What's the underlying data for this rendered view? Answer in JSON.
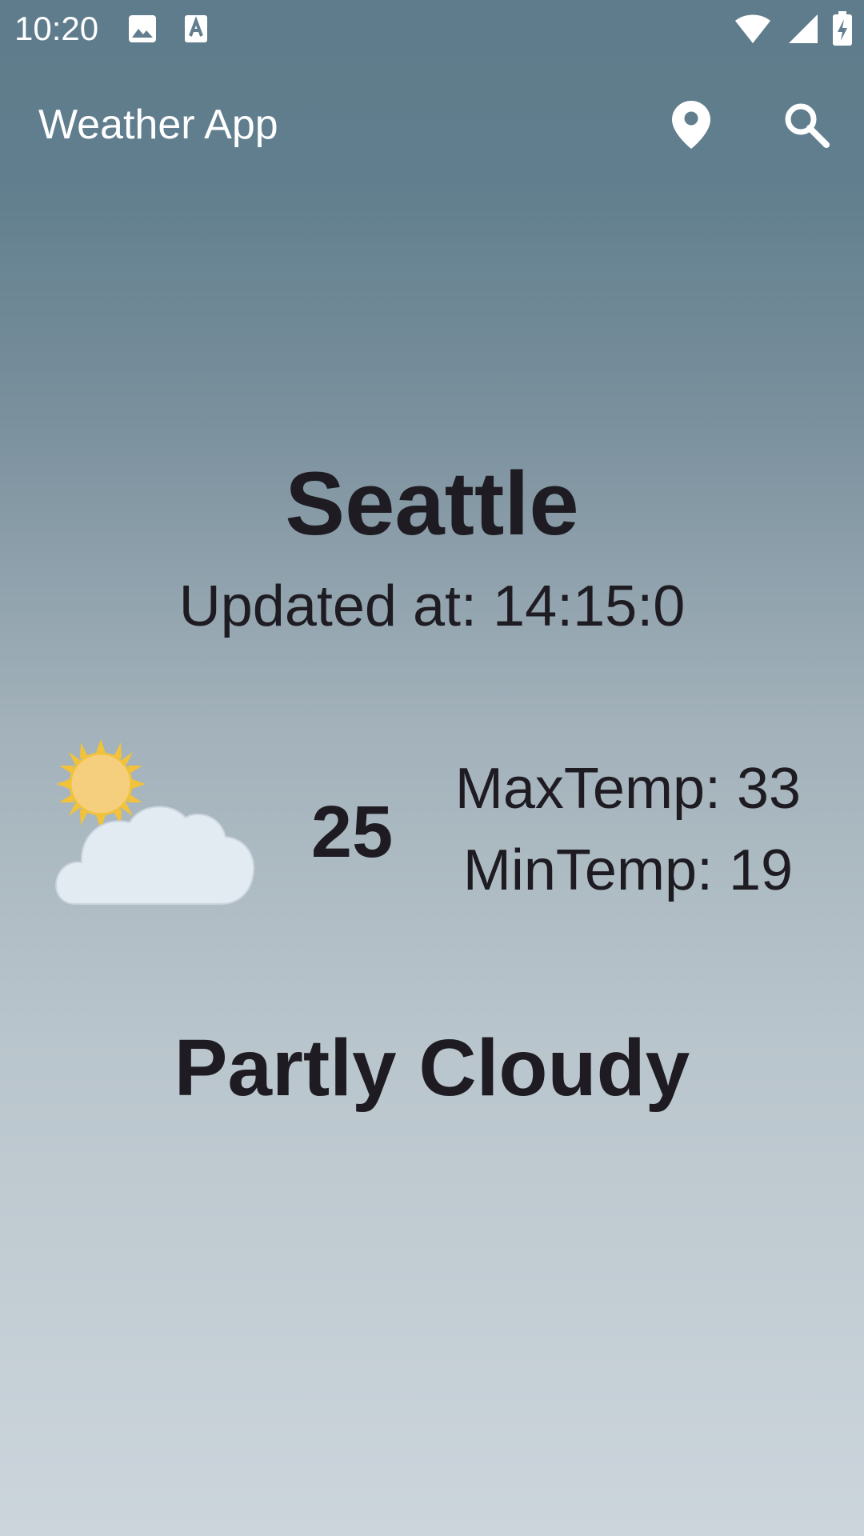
{
  "status_bar": {
    "time": "10:20",
    "icons": [
      "image-icon",
      "text-a-icon",
      "wifi-icon",
      "signal-icon",
      "battery-charging-icon"
    ]
  },
  "app_bar": {
    "title": "Weather App",
    "actions": [
      "location-pin-icon",
      "search-icon"
    ]
  },
  "weather": {
    "city": "Seattle",
    "updated": "Updated at: 14:15:0",
    "temperature": "25",
    "max_temp": "MaxTemp: 33",
    "min_temp": "MinTemp: 19",
    "condition": "Partly Cloudy",
    "icon": "partly-cloudy-icon"
  },
  "colors": {
    "gradient_top": "#5f7c8c",
    "gradient_bottom": "#ccd5dc",
    "text_dark": "#1e1c22",
    "text_light": "#ffffff"
  }
}
